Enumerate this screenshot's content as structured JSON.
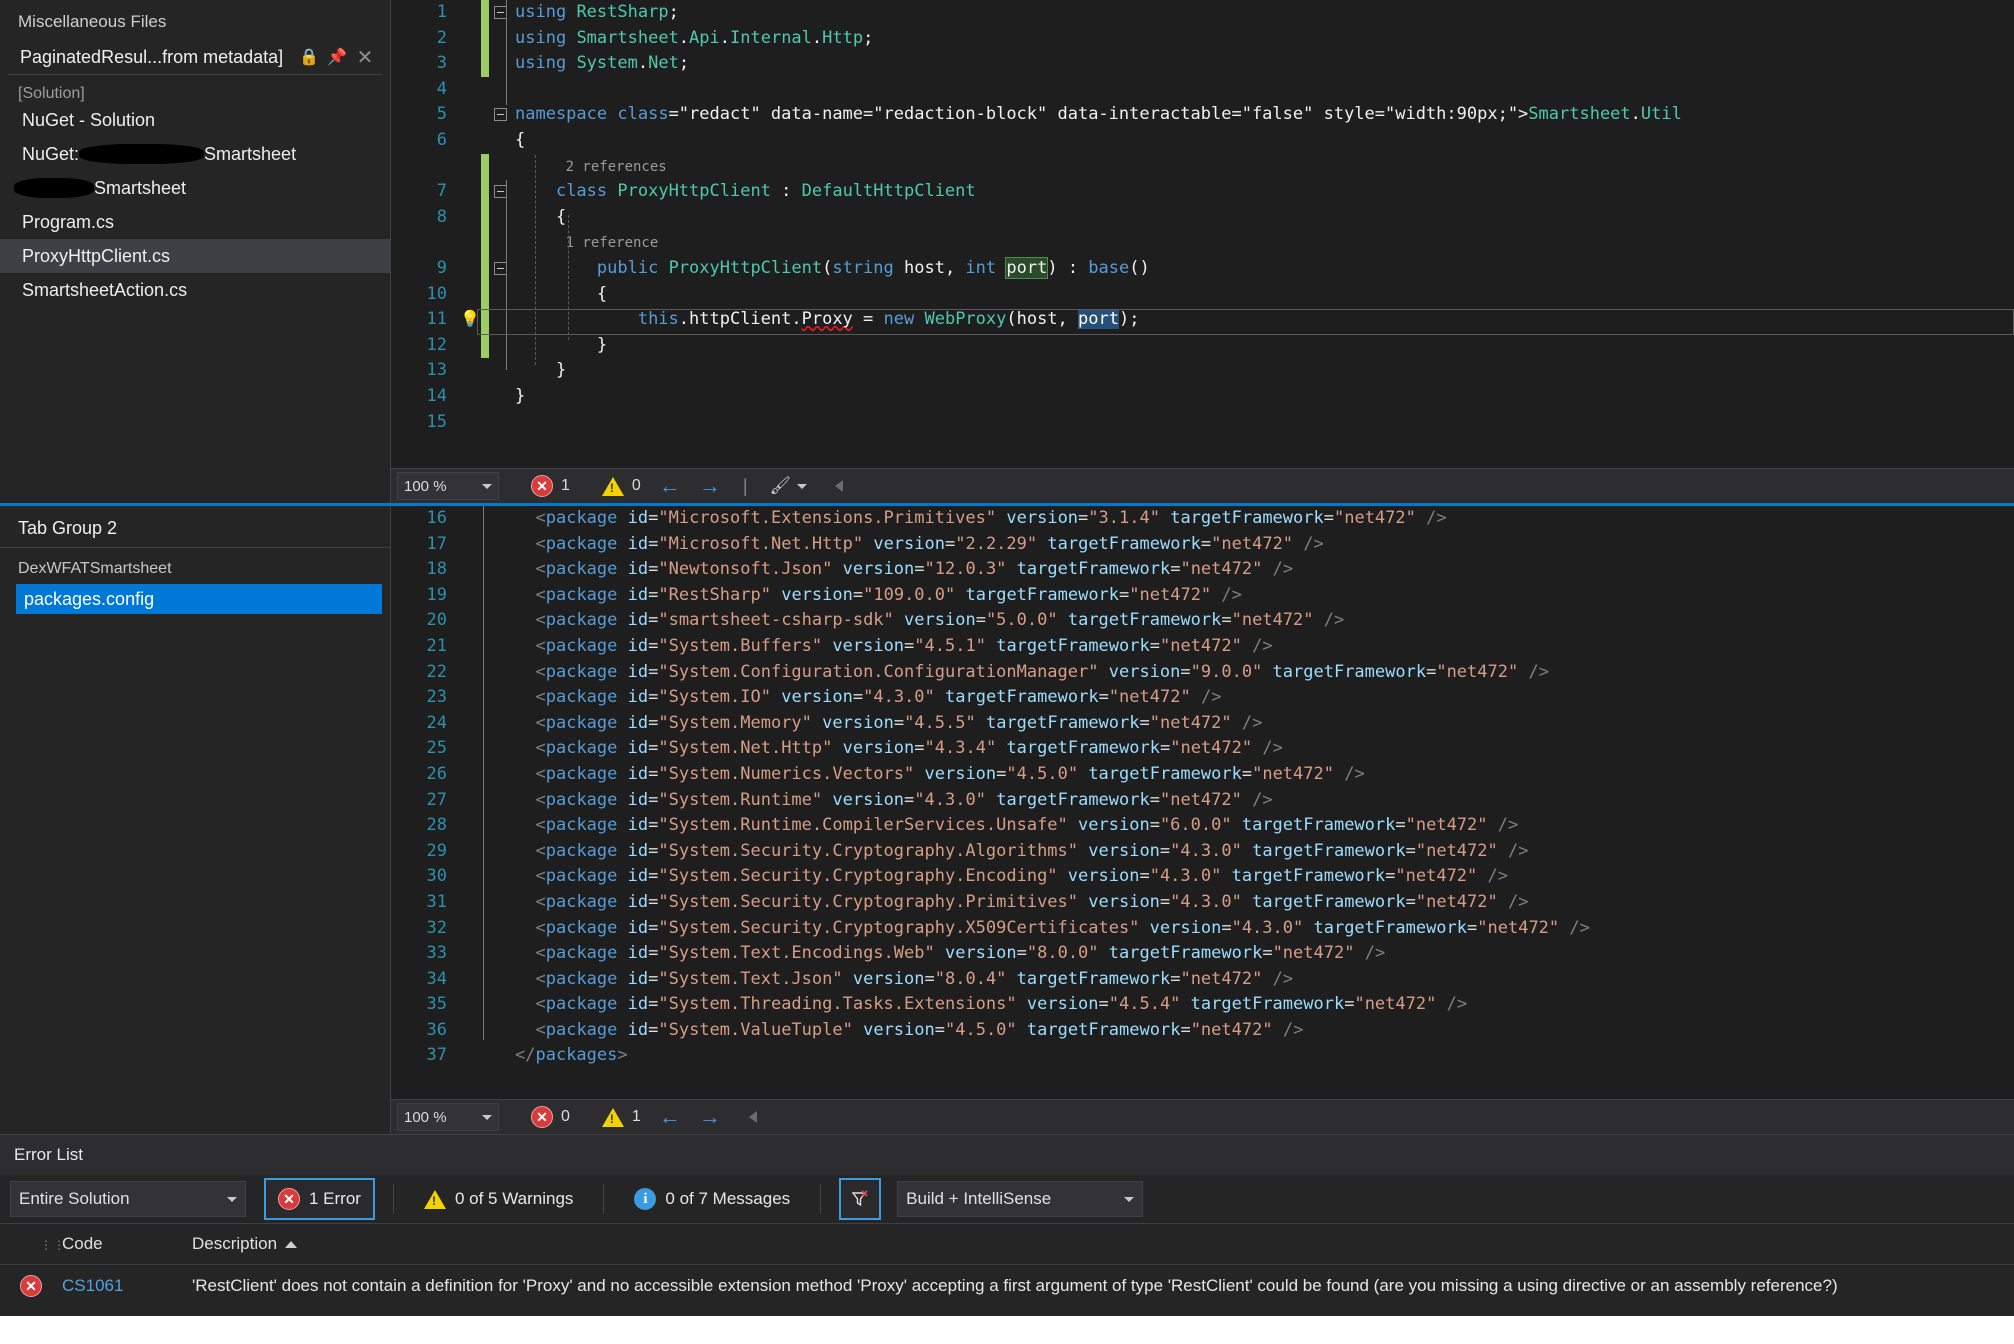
{
  "sidebar": {
    "header": "Miscellaneous Files",
    "tab": {
      "label": "PaginatedResul...from metadata]",
      "lock_icon": "lock-icon",
      "pin_icon": "pin-icon",
      "close_icon": "close-icon"
    },
    "solution_label": "[Solution]",
    "items": [
      {
        "label": "NuGet - Solution",
        "redacted": false,
        "selected": false
      },
      {
        "label": "NuGet:",
        "suffix": "Smartsheet",
        "redacted": true,
        "selected": false
      },
      {
        "label": "",
        "suffix": "Smartsheet",
        "redacted": true,
        "selected": false
      },
      {
        "label": "Program.cs",
        "redacted": false,
        "selected": false
      },
      {
        "label": "ProxyHttpClient.cs",
        "redacted": false,
        "selected": true
      },
      {
        "label": "SmartsheetAction.cs",
        "redacted": false,
        "selected": false
      }
    ]
  },
  "code_editor": {
    "lines": [
      {
        "n": "1",
        "fold": true,
        "saved": true,
        "text": "using RestSharp;"
      },
      {
        "n": "2",
        "fold": false,
        "saved": true,
        "text": "using Smartsheet.Api.Internal.Http;"
      },
      {
        "n": "3",
        "fold": false,
        "saved": true,
        "text": "using System.Net;"
      },
      {
        "n": "4",
        "fold": false,
        "saved": false,
        "text": ""
      },
      {
        "n": "5",
        "fold": true,
        "saved": false,
        "text": "namespace ██████Smartsheet.Util"
      },
      {
        "n": "6",
        "fold": false,
        "saved": false,
        "text": "{"
      },
      {
        "n": "7",
        "fold": true,
        "saved": true,
        "text": "    class ProxyHttpClient : DefaultHttpClient",
        "lens": "2 references"
      },
      {
        "n": "8",
        "fold": false,
        "saved": true,
        "text": "    {"
      },
      {
        "n": "9",
        "fold": true,
        "saved": true,
        "text": "        public ProxyHttpClient(string host, int port) : base()",
        "lens": "1 reference"
      },
      {
        "n": "10",
        "fold": false,
        "saved": true,
        "text": "        {"
      },
      {
        "n": "11",
        "fold": false,
        "saved": true,
        "text": "            this.httpClient.Proxy = new WebProxy(host, port);",
        "bulb": true
      },
      {
        "n": "12",
        "fold": false,
        "saved": true,
        "text": "        }"
      },
      {
        "n": "13",
        "fold": false,
        "saved": false,
        "text": "    }"
      },
      {
        "n": "14",
        "fold": false,
        "saved": false,
        "text": "}"
      },
      {
        "n": "15",
        "fold": false,
        "saved": false,
        "text": ""
      }
    ]
  },
  "code_status": {
    "zoom": "100 %",
    "error_count": "1",
    "warning_count": "0",
    "back_arrow": "←",
    "forward_arrow": "→",
    "divider": "|",
    "brush_icon": "brush-icon"
  },
  "tabgroup2": {
    "title": "Tab Group 2",
    "project": "DexWFATSmartsheet",
    "file": "packages.config"
  },
  "xml_editor": {
    "lines": [
      {
        "n": "16",
        "id": "Microsoft.Extensions.Primitives",
        "version": "3.1.4",
        "tf": "net472"
      },
      {
        "n": "17",
        "id": "Microsoft.Net.Http",
        "version": "2.2.29",
        "tf": "net472"
      },
      {
        "n": "18",
        "id": "Newtonsoft.Json",
        "version": "12.0.3",
        "tf": "net472"
      },
      {
        "n": "19",
        "id": "RestSharp",
        "version": "109.0.0",
        "tf": "net472"
      },
      {
        "n": "20",
        "id": "smartsheet-csharp-sdk",
        "version": "5.0.0",
        "tf": "net472"
      },
      {
        "n": "21",
        "id": "System.Buffers",
        "version": "4.5.1",
        "tf": "net472"
      },
      {
        "n": "22",
        "id": "System.Configuration.ConfigurationManager",
        "version": "9.0.0",
        "tf": "net472"
      },
      {
        "n": "23",
        "id": "System.IO",
        "version": "4.3.0",
        "tf": "net472"
      },
      {
        "n": "24",
        "id": "System.Memory",
        "version": "4.5.5",
        "tf": "net472"
      },
      {
        "n": "25",
        "id": "System.Net.Http",
        "version": "4.3.4",
        "tf": "net472"
      },
      {
        "n": "26",
        "id": "System.Numerics.Vectors",
        "version": "4.5.0",
        "tf": "net472"
      },
      {
        "n": "27",
        "id": "System.Runtime",
        "version": "4.3.0",
        "tf": "net472"
      },
      {
        "n": "28",
        "id": "System.Runtime.CompilerServices.Unsafe",
        "version": "6.0.0",
        "tf": "net472"
      },
      {
        "n": "29",
        "id": "System.Security.Cryptography.Algorithms",
        "version": "4.3.0",
        "tf": "net472"
      },
      {
        "n": "30",
        "id": "System.Security.Cryptography.Encoding",
        "version": "4.3.0",
        "tf": "net472"
      },
      {
        "n": "31",
        "id": "System.Security.Cryptography.Primitives",
        "version": "4.3.0",
        "tf": "net472"
      },
      {
        "n": "32",
        "id": "System.Security.Cryptography.X509Certificates",
        "version": "4.3.0",
        "tf": "net472"
      },
      {
        "n": "33",
        "id": "System.Text.Encodings.Web",
        "version": "8.0.0",
        "tf": "net472"
      },
      {
        "n": "34",
        "id": "System.Text.Json",
        "version": "8.0.4",
        "tf": "net472"
      },
      {
        "n": "35",
        "id": "System.Threading.Tasks.Extensions",
        "version": "4.5.4",
        "tf": "net472"
      },
      {
        "n": "36",
        "id": "System.ValueTuple",
        "version": "4.5.0",
        "tf": "net472"
      }
    ],
    "closing_line": {
      "n": "37",
      "text": "</packages>"
    }
  },
  "xml_status": {
    "zoom": "100 %",
    "error_count": "0",
    "warning_count": "1",
    "back_arrow": "←",
    "forward_arrow": "→"
  },
  "error_list": {
    "title": "Error List",
    "scope": "Entire Solution",
    "errors_button": "1 Error",
    "warnings_button": "0 of 5 Warnings",
    "messages_button": "0 of 7 Messages",
    "filter_icon": "filter-clear-icon",
    "build_filter": "Build + IntelliSense",
    "columns": {
      "code": "Code",
      "description": "Description"
    },
    "rows": [
      {
        "severity": "error",
        "code": "CS1061",
        "description": "'RestClient' does not contain a definition for 'Proxy' and no accessible extension method 'Proxy' accepting a first argument of type 'RestClient' could be found (are you missing a using directive or an assembly reference?)"
      }
    ]
  },
  "colors": {
    "accent": "#007acc",
    "selection": "#0078d7",
    "error": "#d83b3b",
    "warning": "#f2d200",
    "info": "#3d9ae0",
    "editor_bg": "#1e1e1e",
    "panel_bg": "#252526"
  }
}
